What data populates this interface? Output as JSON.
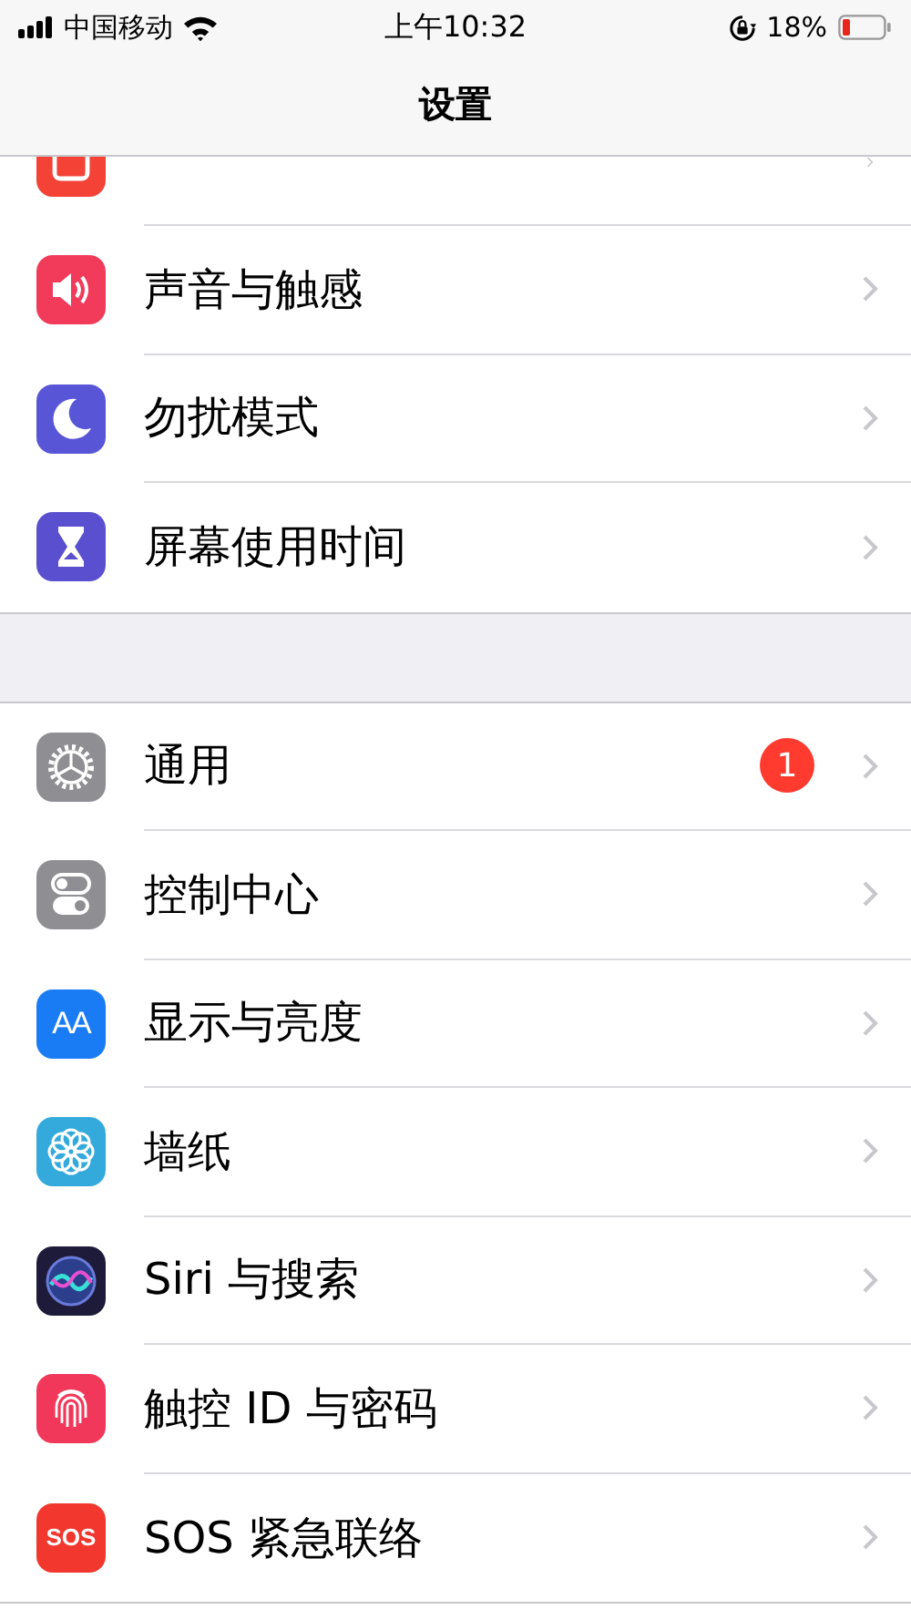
{
  "status_bar": {
    "carrier": "中国移动",
    "time": "上午10:32",
    "battery": "18%"
  },
  "nav": {
    "title": "设置"
  },
  "groups": [
    {
      "items": [
        {
          "color": "#f44336",
          "cut": true
        },
        {
          "label": "声音与触感",
          "color": "#f23a5a"
        },
        {
          "label": "勿扰模式",
          "color": "#5856d6"
        },
        {
          "label": "屏幕使用时间",
          "color": "#5a4fcf"
        }
      ]
    },
    {
      "items": [
        {
          "label": "通用",
          "color": "#8e8e93",
          "badge": "1"
        },
        {
          "label": "控制中心",
          "color": "#8e8e93"
        },
        {
          "label": "显示与亮度",
          "color": "#1a7cf5",
          "icon_text": "AA"
        },
        {
          "label": "墙纸",
          "color": "#34aadc"
        },
        {
          "label": "Siri 与搜索",
          "color": "#1e1b3a"
        },
        {
          "label": "触控 ID 与密码",
          "color": "#f2385a"
        },
        {
          "label": "SOS 紧急联络",
          "color": "#f2382e",
          "icon_text": "SOS"
        }
      ]
    }
  ]
}
